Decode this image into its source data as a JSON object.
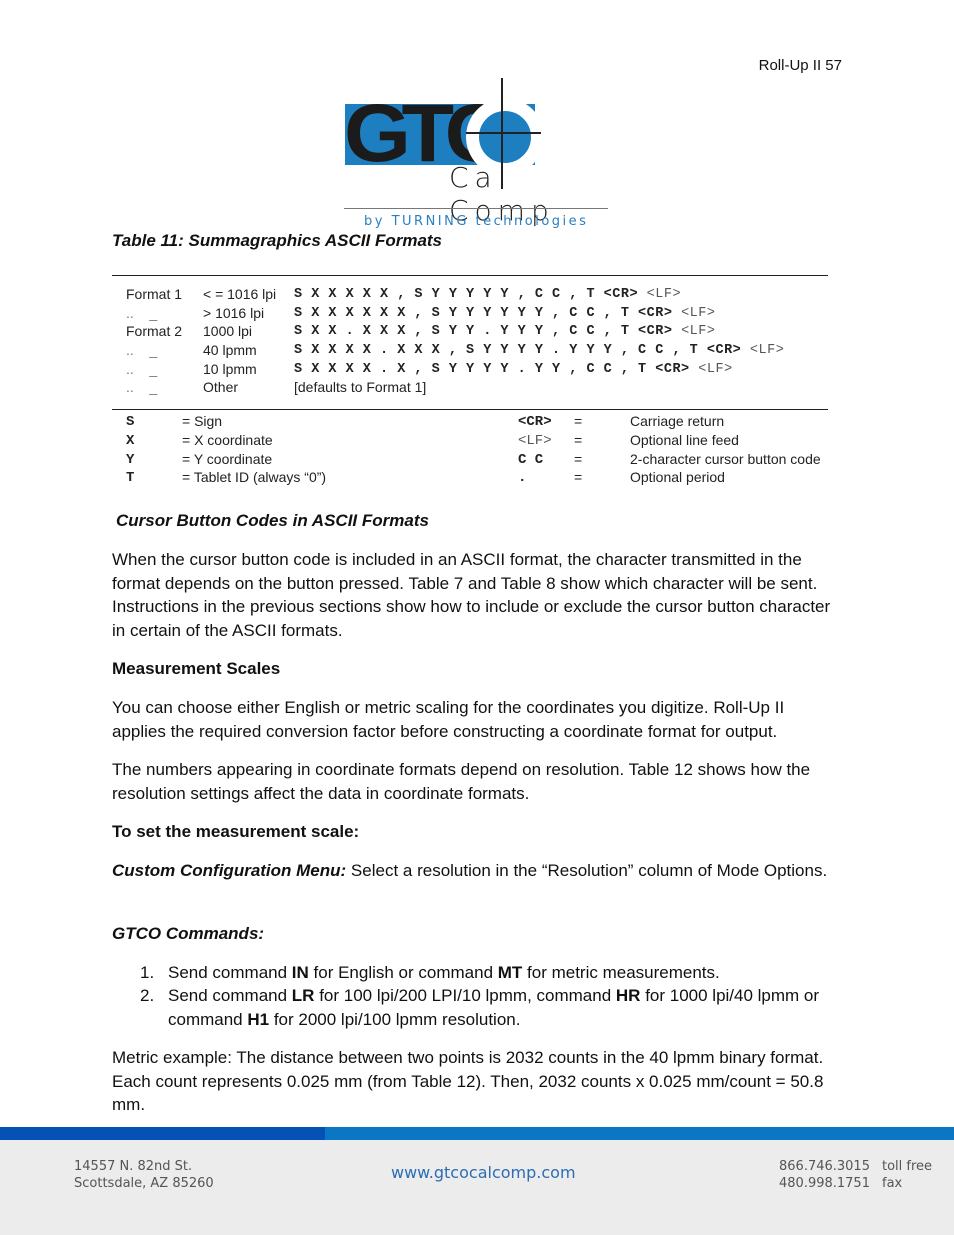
{
  "header": {
    "page_label": "Roll-Up II 57"
  },
  "logo": {
    "brand_main": "GTC",
    "brand_sub": "Ca",
    "brand_sub2": "Comp",
    "tagline": "by TURNING technologies",
    "colors": {
      "blue": "#1d7ec0",
      "dark": "#1b1b1b",
      "tagline": "#2a7fc0"
    }
  },
  "table11": {
    "caption": "Table 11: Summagraphics ASCII Formats",
    "formats": [
      {
        "label": "Format 1",
        "resolution": "< = 1016 lpi",
        "code": "S X X X X X , S Y Y Y Y Y , C C , T <CR>",
        "lf": "<LF>"
      },
      {
        "label": "..    _",
        "resolution": "> 1016 lpi",
        "code": "S X X X X X X , S Y Y Y Y Y Y , C C , T <CR>",
        "lf": "<LF>"
      },
      {
        "label": "Format 2",
        "resolution": "1000 lpi",
        "code": "S X X . X X X , S Y Y . Y Y Y , C C , T <CR>",
        "lf": "<LF>"
      },
      {
        "label": "..    _",
        "resolution": "40 lpmm",
        "code": "S X X X X . X X X , S Y Y Y Y . Y Y Y , C C , T <CR>",
        "lf": "<LF>"
      },
      {
        "label": "..    _",
        "resolution": "10 lpmm",
        "code": "S X X X X . X , S Y Y Y Y . Y Y , C C , T <CR>",
        "lf": "<LF>"
      },
      {
        "label": "..    _",
        "resolution": "Other",
        "code": "",
        "lf": "",
        "note": "[defaults to Format 1]"
      }
    ],
    "legend_left": [
      {
        "symbol": "S",
        "meaning": "= Sign"
      },
      {
        "symbol": "X",
        "meaning": "= X coordinate"
      },
      {
        "symbol": "Y",
        "meaning": "= Y coordinate"
      },
      {
        "symbol": "T",
        "meaning": "= Tablet ID (always “0”)"
      }
    ],
    "legend_right": [
      {
        "symbol": "<CR>",
        "eq": "=",
        "meaning": "Carriage return"
      },
      {
        "symbol": "<LF>",
        "eq": "=",
        "meaning": "Optional line feed"
      },
      {
        "symbol": "C C",
        "eq": "=",
        "meaning": "2-character cursor button code"
      },
      {
        "symbol": ".",
        "eq": "=",
        "meaning": "Optional period"
      }
    ]
  },
  "sections": {
    "cursor_heading": "Cursor Button Codes in ASCII Formats",
    "cursor_para": "When the cursor button code is included in an ASCII format, the character transmitted in the format depends on the button pressed.  Table 7 and Table 8 show which character will be sent.  Instructions in the previous sections show how to include or exclude the cursor button character in certain of the ASCII formats.",
    "measure_heading": "Measurement Scales",
    "measure_para1": "You can choose either English or metric scaling for the coordinates you digitize.  Roll-Up II applies the required conversion factor before constructing a coordinate format for output.",
    "measure_para2": "The numbers appearing in coordinate formats depend on resolution.  Table 12 shows how the resolution settings affect the data in coordinate formats.",
    "set_heading": "To set the measurement scale:",
    "custom_label": "Custom Configuration Menu:",
    "custom_text": " Select a resolution in the “Resolution” column of Mode Options.",
    "gtco_heading": "GTCO Commands:",
    "steps": [
      {
        "num": "1.",
        "parts": [
          "Send command ",
          "IN",
          " for English or command ",
          "MT",
          " for metric measurements."
        ]
      },
      {
        "num": "2.",
        "parts": [
          "Send command ",
          "LR",
          " for 100 lpi/200 LPI/10 lpmm, command ",
          "HR",
          " for 1000 lpi/40 lpmm or command ",
          "H1",
          " for 2000 lpi/100 lpmm resolution."
        ]
      }
    ],
    "metric_example": "Metric example: The distance between two points is 2032 counts in the 40 lpmm binary format.  Each count represents 0.025 mm (from Table 12).  Then, 2032 counts x 0.025 mm/count = 50.8 mm."
  },
  "footer": {
    "address_line1": "14557 N. 82nd St.",
    "address_line2": "Scottsdale, AZ 85260",
    "url": "www.gtcocalcomp.com",
    "phone": "866.746.3015",
    "phone_label": "toll free",
    "fax": "480.998.1751",
    "fax_label": "fax",
    "colors": {
      "bar_dark": "#0452b6",
      "bar_light": "#0a76c4",
      "background": "#ececec"
    }
  }
}
